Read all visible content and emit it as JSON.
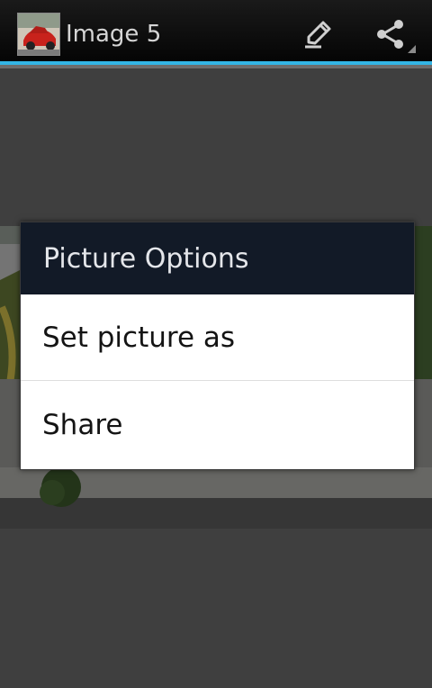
{
  "action_bar": {
    "title": "Image 5",
    "icons": [
      "edit-icon",
      "share-icon"
    ],
    "accent_color": "#33b5e5"
  },
  "dialog": {
    "title": "Picture Options",
    "items": [
      {
        "label": "Set picture as"
      },
      {
        "label": "Share"
      }
    ]
  }
}
